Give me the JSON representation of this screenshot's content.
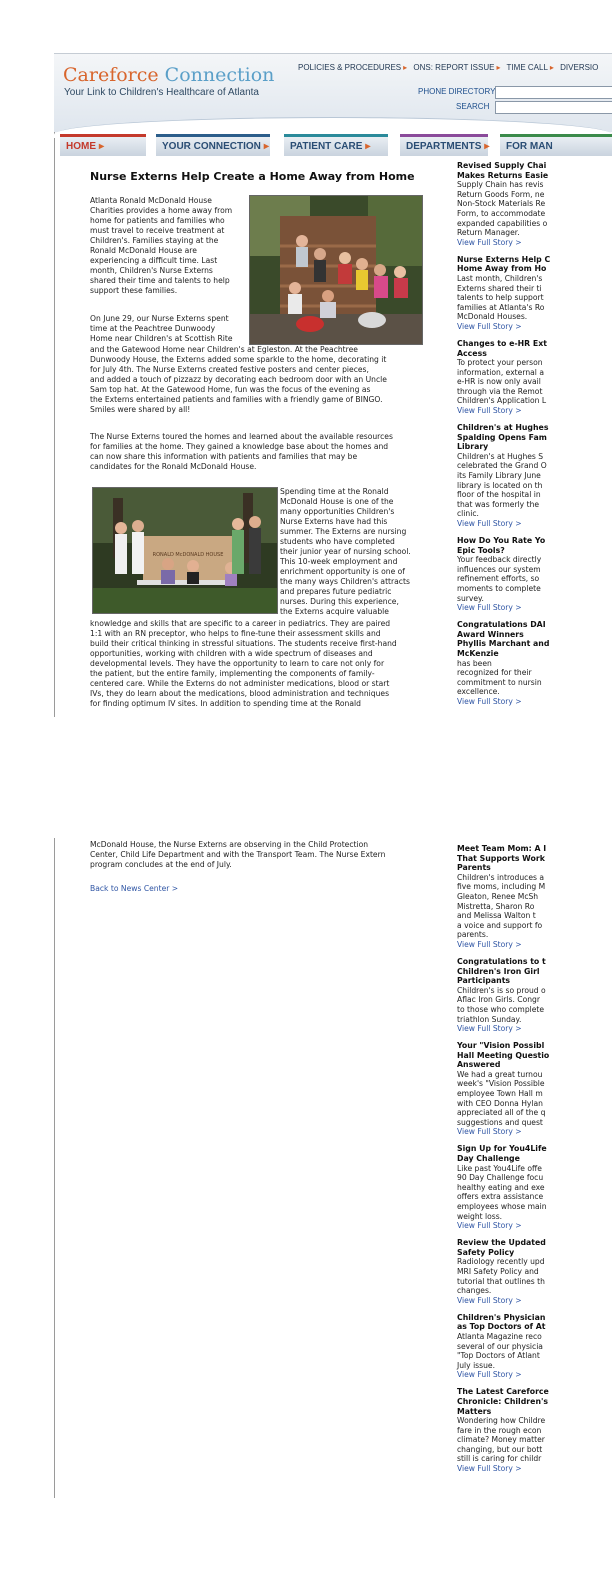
{
  "header": {
    "logo_part1": "Careforce",
    "logo_part2": " Connection",
    "tagline": "Your Link to Children's Healthcare of Atlanta",
    "top_links": [
      "POLICIES & PROCEDURES",
      "ONS: REPORT ISSUE",
      "TIME CALL",
      "DIVERSIO"
    ],
    "phone_directory_label": "PHONE DIRECTORY",
    "search_label": "SEARCH"
  },
  "nav": [
    "HOME",
    "YOUR CONNECTION",
    "PATIENT CARE",
    "DEPARTMENTS",
    "FOR MAN"
  ],
  "colors": {
    "brand_orange": "#d8652d",
    "brand_blue": "#5a9fc8",
    "link_blue": "#2f55a4",
    "nav_text": "#2a4d74"
  },
  "article": {
    "title": "Nurse Externs Help Create a Home Away from Home",
    "p1": "Atlanta Ronald McDonald House\nCharities provides a home away from\nhome for patients and families who\nmust travel to receive treatment at\nChildren's. Families staying at the\nRonald McDonald House are\nexperiencing a difficult time. Last\nmonth, Children's Nurse Externs\nshared their time and talents to help\nsupport these families.",
    "p2_wrap": "On June 29, our Nurse Externs spent\ntime at the Peachtree Dunwoody\nHome near Children's at Scottish Rite",
    "p2_full": "and the Gatewood Home near Children's at Egleston. At the Peachtree\nDunwoody House, the Externs added some sparkle to the home, decorating it\nfor July 4th. The Nurse Externs created festive posters and center pieces,\nand added a touch of pizzazz by decorating each bedroom door with an Uncle\nSam top hat. At the Gatewood Home, fun was the focus of the evening as\nthe Externs entertained patients and families with a friendly game of BINGO.\nSmiles were shared by all!",
    "p3": "The Nurse Externs toured the homes and learned about the available resources\nfor families at the home. They gained a knowledge base about the homes and\ncan now share this information with patients and families that may be\ncandidates for the Ronald McDonald House.",
    "p4_wrap": "Spending time at the Ronald\nMcDonald House is one of the\nmany opportunities Children's\nNurse Externs have had this\nsummer. The Externs are nursing\nstudents who have completed\ntheir junior year of nursing school.\nThis 10-week employment and\nenrichment opportunity is one of\nthe many ways Children's attracts\nand prepares future pediatric\nnurses. During this experience,\nthe Externs acquire valuable",
    "p4_full": "knowledge and skills that are specific to a career in pediatrics. They are paired\n1:1 with an RN preceptor, who helps to fine-tune their assessment skills and\nbuild their critical thinking in stressful situations. The students receive first-hand\nopportunities, working with children with a wide spectrum of diseases and\ndevelopmental levels. They have the opportunity to learn to care not only for\nthe patient, but the entire family, implementing the components of family-\ncentered care. While the Externs do not administer medications, blood or start\nIVs, they do learn about the medications, blood administration and techniques\nfor finding optimum IV sites. In addition to spending time at the Ronald",
    "p4_cont": "McDonald House, the Nurse Externs are observing in the Child Protection\nCenter, Child Life Department and with the Transport Team. The Nurse Extern\nprogram concludes at the end of July.",
    "back_link": "Back to News Center >",
    "photo2_sign": "RONALD McDONALD HOUSE"
  },
  "sidebar_page1": [
    {
      "title": "Revised Supply Chai\nMakes Returns Easie",
      "body": "Supply Chain has revis\nReturn Goods Form, ne\nNon-Stock Materials Re\nForm, to accommodate\nexpanded capabilities o\nReturn Manager.",
      "link": "View Full Story >"
    },
    {
      "title": "Nurse Externs Help C\nHome Away from Ho",
      "body": "Last month, Children's\nExterns shared their ti\ntalents to help support\nfamilies at Atlanta's Ro\nMcDonald Houses.",
      "link": "View Full Story >"
    },
    {
      "title": "Changes to e-HR Ext\nAccess",
      "body": "To protect your person\ninformation, external a\ne-HR is now only avail\nthrough via the Remot\nChildren's Application L",
      "link": "View Full Story >"
    },
    {
      "title": "Children's at Hughes\nSpalding Opens Fam\nLibrary",
      "body": "Children's at Hughes S\ncelebrated the Grand O\nits Family Library June\nlibrary is located on th\nfloor of the hospital in\nthat was formerly the\nclinic.",
      "link": "View Full Story >"
    },
    {
      "title": "How Do You Rate Yo\nEpic Tools?",
      "body": "Your feedback directly\ninfluences our system\nrefinement efforts, so\nmoments to complete\nsurvey.",
      "link": "View Full Story >"
    },
    {
      "title": "Congratulations DAI\nAward Winners\nPhyllis Marchant and\nMcKenzie",
      "body": "has been\nrecognized for their\ncommitment to nursin\nexcellence.",
      "link": "View Full Story >"
    }
  ],
  "sidebar_page2": [
    {
      "title": "Meet Team Mom: A I\nThat Supports Work\nParents",
      "body": "Children's introduces a\nfive moms, including M\nGleaton, Renee McSh\nMistretta, Sharon Ro\nand Melissa Walton t\na voice and support fo\nparents.",
      "link": "View Full Story >"
    },
    {
      "title": "Congratulations to t\nChildren's Iron Girl\nParticipants",
      "body": "Children's is so proud o\nAflac Iron Girls. Congr\nto those who complete\ntriathlon Sunday.",
      "link": "View Full Story >"
    },
    {
      "title": "Your \"Vision Possibl\nHall Meeting Questio\nAnswered",
      "body": "We had a great turnou\nweek's \"Vision Possible\nemployee Town Hall m\nwith CEO Donna Hylan\nappreciated all of the q\nsuggestions and quest",
      "link": "View Full Story >"
    },
    {
      "title": "Sign Up for You4Life\nDay Challenge",
      "body": "Like past You4Life offe\n90 Day Challenge focu\nhealthy eating and exe\noffers extra assistance\nemployees whose main\nweight loss.",
      "link": "View Full Story >"
    },
    {
      "title": "Review the Updated\nSafety Policy",
      "body": "Radiology recently upd\nMRI Safety Policy and\ntutorial that outlines th\nchanges.",
      "link": "View Full Story >"
    },
    {
      "title": "Children's Physician\nas Top Doctors of At",
      "body": "Atlanta Magazine reco\nseveral of our physicia\n\"Top Doctors of Atlant\nJuly issue.",
      "link": "View Full Story >"
    },
    {
      "title": "The Latest Careforce\nChronicle: Children's\nMatters",
      "body": "Wondering how Childre\nfare in the rough econ\nclimate? Money matter\nchanging, but our bott\nstill is caring for childr",
      "link": "View Full Story >"
    }
  ]
}
